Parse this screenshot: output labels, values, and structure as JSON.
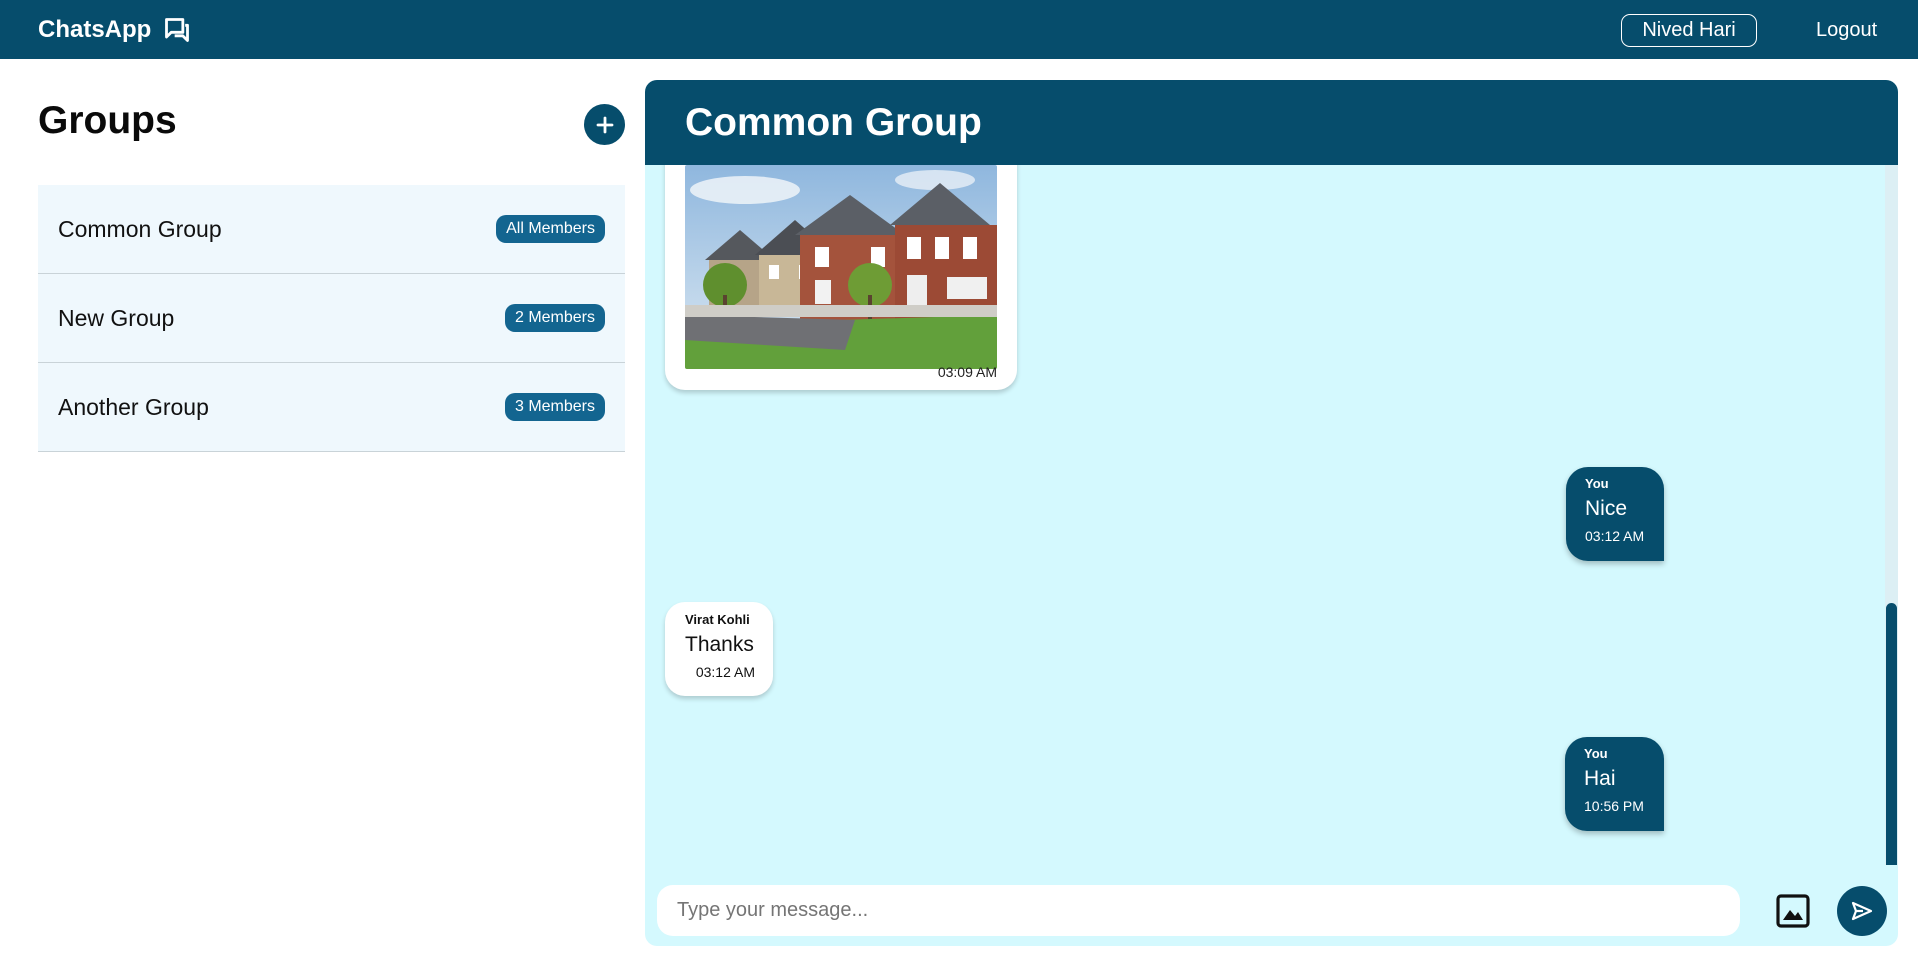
{
  "navbar": {
    "brand": "ChatsApp",
    "brand_icon": "chat-bubbles-icon",
    "user_name": "Nived Hari",
    "logout_label": "Logout"
  },
  "sidebar": {
    "title": "Groups",
    "add_icon": "plus-icon",
    "groups": [
      {
        "name": "Common Group",
        "badge": "All Members"
      },
      {
        "name": "New Group",
        "badge": "2 Members"
      },
      {
        "name": "Another Group",
        "badge": "3 Members"
      }
    ]
  },
  "chat": {
    "title": "Common Group",
    "messages": [
      {
        "type": "image",
        "direction": "in",
        "image": "house-photo",
        "time": "03:09 AM"
      },
      {
        "type": "text",
        "direction": "out",
        "sender": "You",
        "text": "Nice",
        "time": "03:12 AM"
      },
      {
        "type": "text",
        "direction": "in",
        "sender": "Virat Kohli",
        "text": "Thanks",
        "time": "03:12 AM"
      },
      {
        "type": "text",
        "direction": "out",
        "sender": "You",
        "text": "Hai",
        "time": "10:56 PM"
      }
    ],
    "input": {
      "placeholder": "Type your message...",
      "value": ""
    },
    "image_button_icon": "image-icon",
    "send_button_icon": "send-icon"
  },
  "colors": {
    "primary": "#064d6c",
    "badge": "#136590",
    "chat_background": "#d4f9fe",
    "group_item_background": "#eff8fd"
  }
}
